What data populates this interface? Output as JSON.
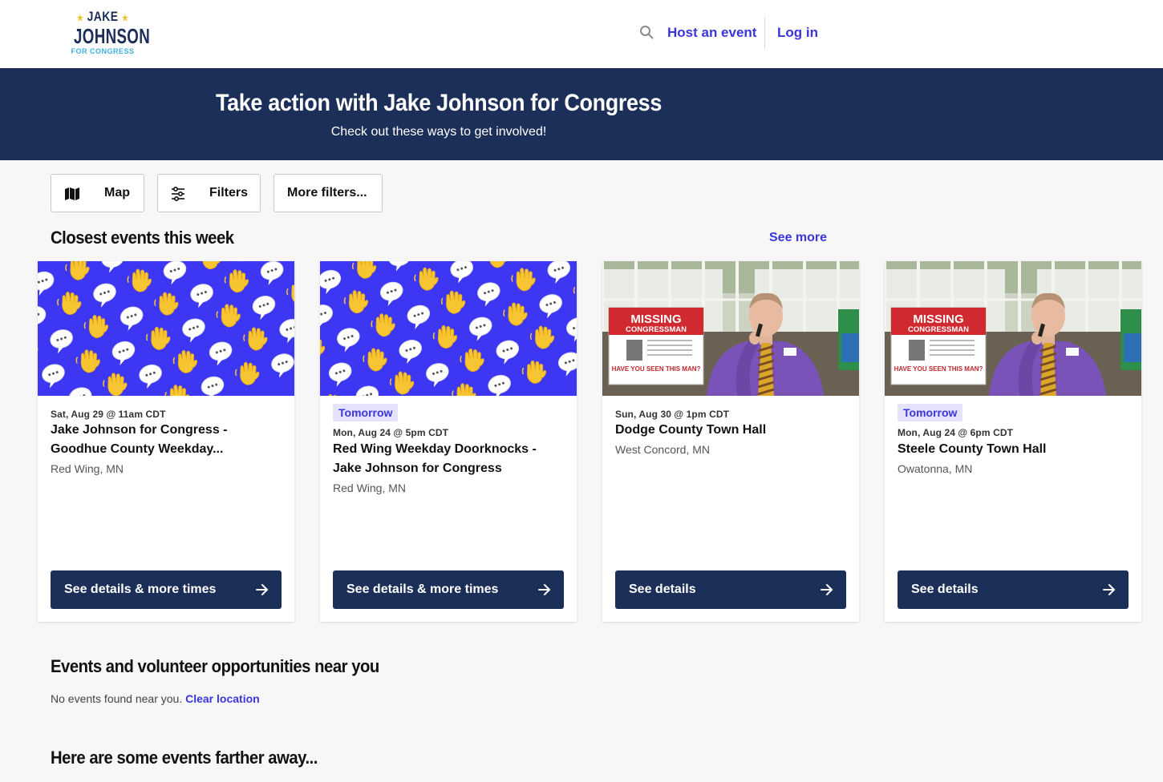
{
  "header": {
    "logo": {
      "line1": "JAKE",
      "line2": "JOHNSON",
      "line3": "FOR CONGRESS"
    },
    "search_icon": "search-icon",
    "host_event_label": "Host an event",
    "login_label": "Log in"
  },
  "hero": {
    "title": "Take action with Jake Johnson for Congress",
    "subtitle": "Check out these ways to get involved!"
  },
  "filters": {
    "map_label": "Map",
    "map_icon": "map-icon",
    "filters_label": "Filters",
    "filters_icon": "sliders-icon",
    "more_filters_label": "More filters..."
  },
  "closest": {
    "heading": "Closest events this week",
    "see_more_label": "See more",
    "cards": [
      {
        "image": "waving-hands-pattern",
        "badge": "",
        "date": "Sat, Aug 29 @ 11am CDT",
        "title": "Jake Johnson for Congress - Goodhue County Weekday...",
        "location": "Red Wing, MN",
        "cta": "See details & more times"
      },
      {
        "image": "waving-hands-pattern",
        "badge": "Tomorrow",
        "date": "Mon, Aug 24 @ 5pm CDT",
        "title": "Red Wing Weekday Doorknocks - Jake Johnson for Congress",
        "location": "Red Wing, MN",
        "cta": "See details & more times"
      },
      {
        "image": "town-hall-photo",
        "badge": "",
        "date": "Sun, Aug 30 @ 1pm CDT",
        "title": "Dodge County Town Hall",
        "location": "West Concord, MN",
        "cta": "See details"
      },
      {
        "image": "town-hall-photo",
        "badge": "Tomorrow",
        "date": "Mon, Aug 24 @ 6pm CDT",
        "title": "Steele County Town Hall",
        "location": "Owatonna, MN",
        "cta": "See details"
      }
    ]
  },
  "photo_poster": {
    "line1": "MISSING",
    "line2": "CONGRESSMAN",
    "line3": "HAVE YOU SEEN THIS MAN?"
  },
  "nearby": {
    "heading": "Events and volunteer opportunities near you",
    "empty_text": "No events found near you.",
    "clear_label": "Clear location"
  },
  "farther": {
    "heading": "Here are some events farther away..."
  },
  "colors": {
    "brand_navy": "#1c2f59",
    "link_blue": "#3b35dd",
    "pattern_blue": "#3d36f2",
    "badge_bg": "#e4e3fb"
  }
}
